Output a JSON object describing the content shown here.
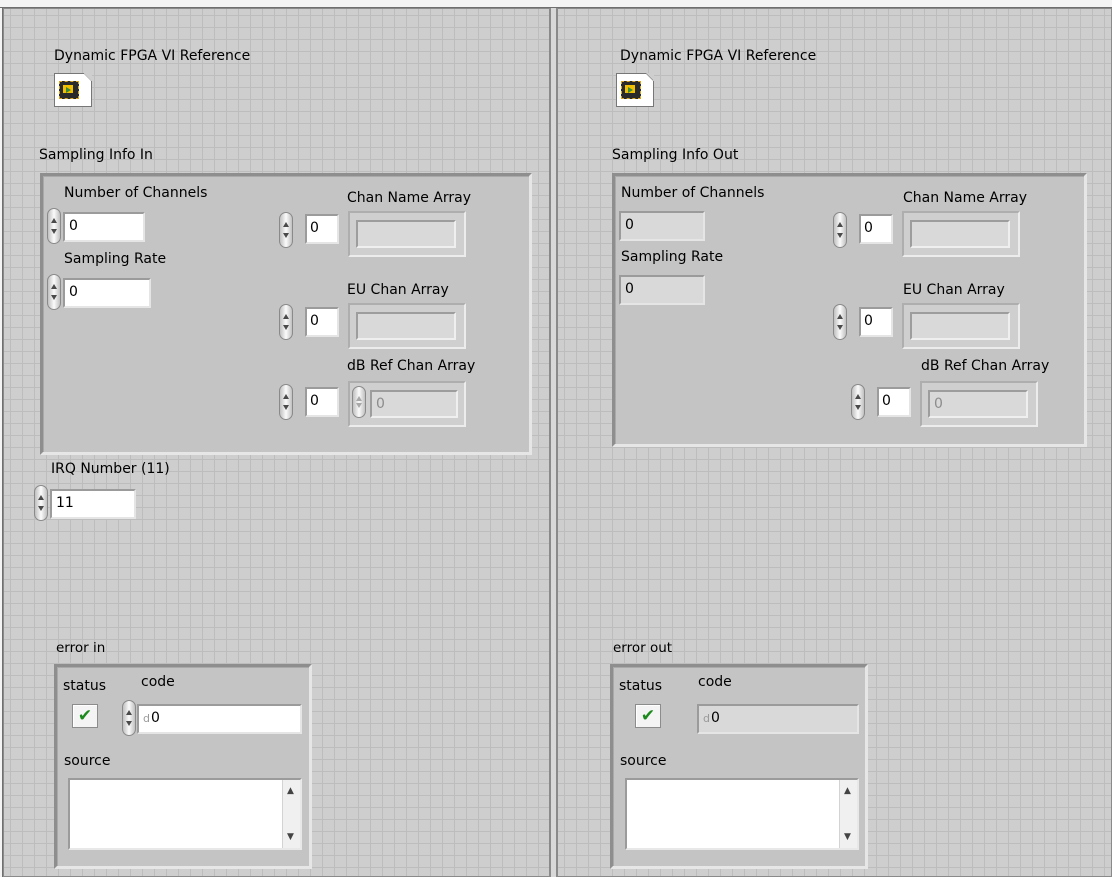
{
  "left": {
    "fpga_label": "Dynamic FPGA VI Reference",
    "sampling_label": "Sampling Info In",
    "num_channels_label": "Number of Channels",
    "num_channels_value": "0",
    "sampling_rate_label": "Sampling Rate",
    "sampling_rate_value": "0",
    "chan_name_label": "Chan Name Array",
    "chan_name_index": "0",
    "eu_chan_label": "EU Chan Array",
    "eu_chan_index": "0",
    "db_ref_label": "dB Ref Chan Array",
    "db_ref_index": "0",
    "db_ref_value": "0",
    "irq_label": "IRQ Number (11)",
    "irq_value": "11",
    "error_label": "error in",
    "status_label": "status",
    "code_label": "code",
    "code_value": "0",
    "code_prefix": "d",
    "source_label": "source"
  },
  "right": {
    "fpga_label": "Dynamic FPGA VI Reference",
    "sampling_label": "Sampling Info Out",
    "num_channels_label": "Number of Channels",
    "num_channels_value": "0",
    "sampling_rate_label": "Sampling Rate",
    "sampling_rate_value": "0",
    "chan_name_label": "Chan Name Array",
    "chan_name_index": "0",
    "eu_chan_label": "EU Chan Array",
    "eu_chan_index": "0",
    "db_ref_label": "dB Ref Chan Array",
    "db_ref_index": "0",
    "db_ref_value": "0",
    "error_label": "error out",
    "status_label": "status",
    "code_label": "code",
    "code_value": "0",
    "code_prefix": "d",
    "source_label": "source"
  },
  "icons": {
    "status_check": "✔",
    "fpga": "fpga-chip-icon",
    "scroll_up": "▲",
    "scroll_down": "▼"
  },
  "colors": {
    "panel_bg": "#cecece",
    "grid": "#bdbdbd",
    "status_ok": "#1c8a1c",
    "fpga_chip": "#f2c000"
  }
}
